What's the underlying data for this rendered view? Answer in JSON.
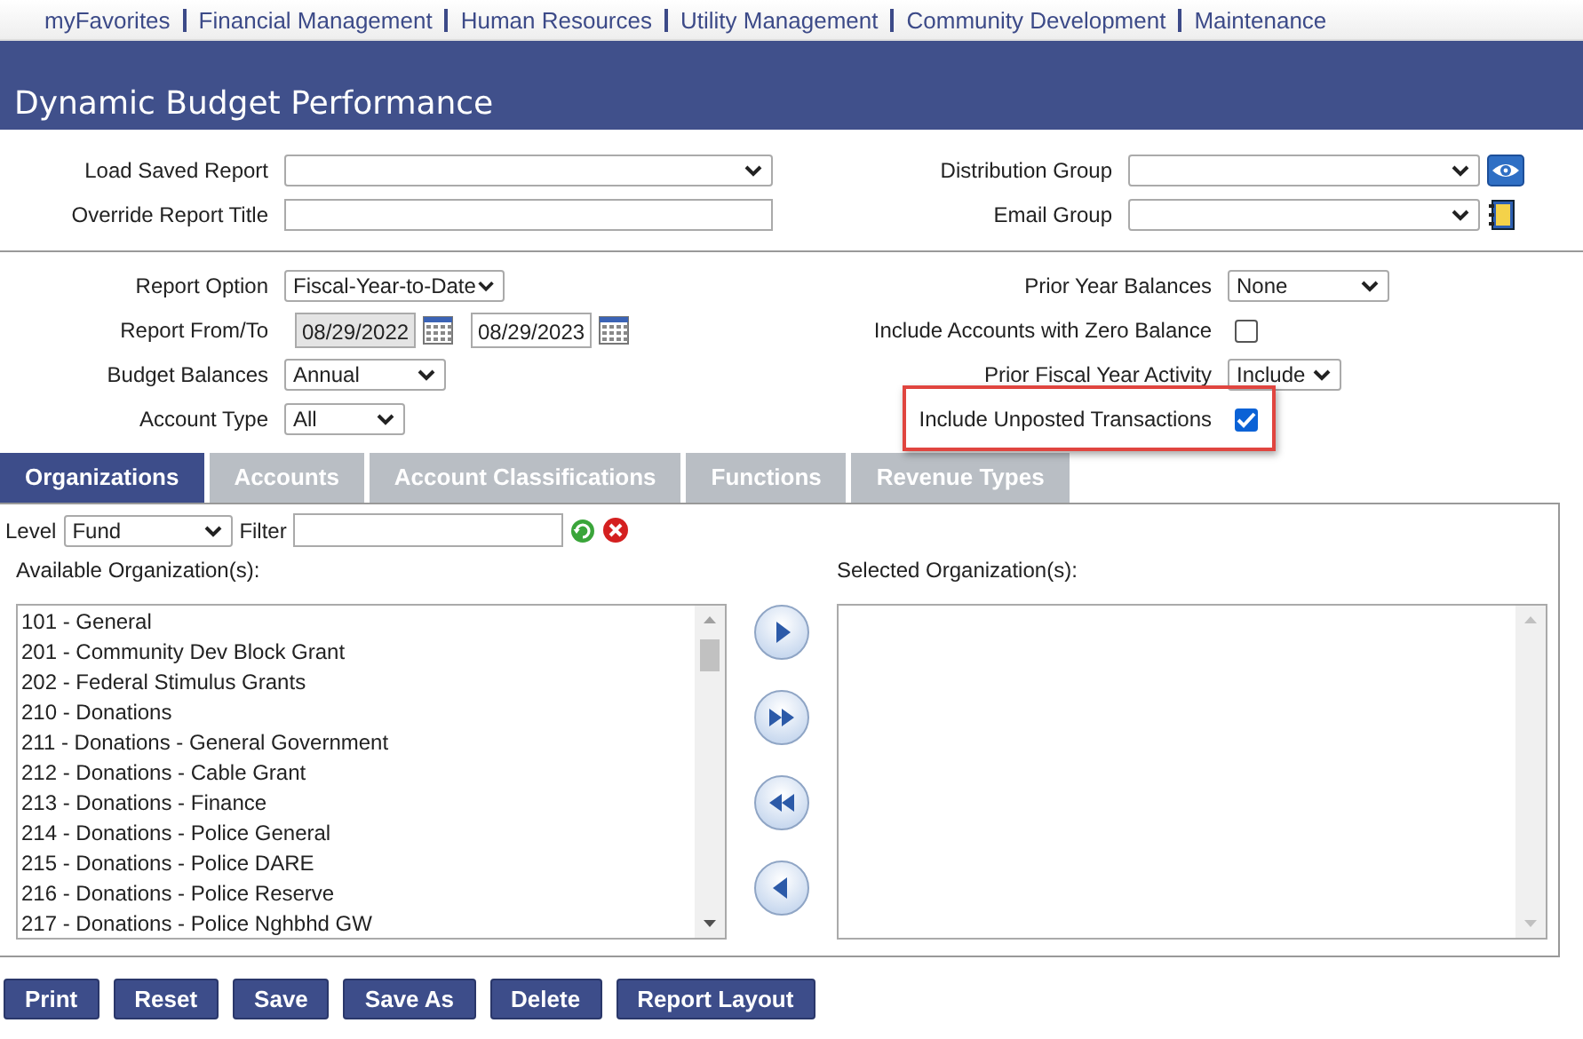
{
  "nav": [
    "myFavorites",
    "Financial Management",
    "Human Resources",
    "Utility Management",
    "Community Development",
    "Maintenance"
  ],
  "header": {
    "title": "Dynamic Budget Performance"
  },
  "report_left": [
    {
      "kind": "select",
      "label": "Load Saved Report"
    },
    {
      "kind": "text",
      "label": "Override Report Title"
    }
  ],
  "report_right": [
    {
      "kind": "select_preview",
      "label": "Distribution Group"
    },
    {
      "kind": "select_contacts",
      "label": "Email Group"
    }
  ],
  "options_left": [
    {
      "kind": "select",
      "label": "Report Option",
      "value": "Fiscal-Year-to-Date"
    },
    {
      "kind": "date_range",
      "label": "Report From/To",
      "from": {
        "value": "08/29/2022",
        "disabled": true
      },
      "to": {
        "value": "08/29/2023",
        "disabled": false
      }
    },
    {
      "kind": "select",
      "label": "Budget Balances",
      "value": "Annual"
    },
    {
      "kind": "select",
      "label": "Account Type",
      "value": "All"
    }
  ],
  "options_right": [
    {
      "kind": "select",
      "label": "Prior Year Balances",
      "value": "None"
    },
    {
      "kind": "checkbox",
      "label": "Include Accounts with Zero Balance",
      "checked": false,
      "highlighted": false
    },
    {
      "kind": "select",
      "label": "Prior Fiscal Year Activity",
      "value": "Include"
    },
    {
      "kind": "checkbox",
      "label": "Include Unposted Transactions",
      "checked": true,
      "highlighted": true
    }
  ],
  "tabs": [
    {
      "label": "Organizations",
      "selected": true
    },
    {
      "label": "Accounts",
      "selected": false
    },
    {
      "label": "Account Classifications",
      "selected": false
    },
    {
      "label": "Functions",
      "selected": false
    },
    {
      "label": "Revenue Types",
      "selected": false
    }
  ],
  "filter_bar": {
    "level_label": "Level",
    "level_value": "Fund",
    "filter_label": "Filter"
  },
  "available": {
    "title": "Available Organization(s):",
    "items": [
      "101 - General",
      "201 - Community Dev Block Grant",
      "202 - Federal Stimulus Grants",
      "210 - Donations",
      "211 - Donations - General Government",
      "212 - Donations - Cable Grant",
      "213 - Donations - Finance",
      "214 - Donations - Police General",
      "215 - Donations - Police DARE",
      "216 - Donations - Police Reserve",
      "217 - Donations - Police Nghbhd GW"
    ]
  },
  "selected": {
    "title": "Selected Organization(s):"
  },
  "buttons": [
    "Print",
    "Reset",
    "Save",
    "Save As",
    "Delete",
    "Report Layout"
  ]
}
